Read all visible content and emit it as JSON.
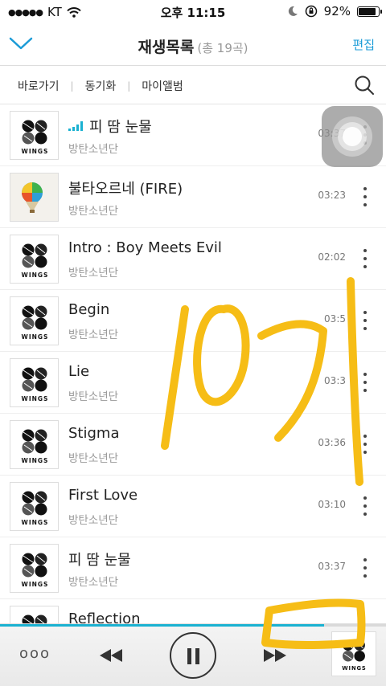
{
  "status_bar": {
    "carrier": "KT",
    "time": "오후 11:15",
    "battery": "92%",
    "battery_level": 0.92
  },
  "header": {
    "title": "재생목록",
    "count": "(총 19곡)",
    "edit_label": "편집",
    "back_icon": "chevron-down-icon"
  },
  "subnav": {
    "items": [
      "바로가기",
      "동기화",
      "마이앨범"
    ],
    "search_icon": "search-icon"
  },
  "songs": [
    {
      "title": "피 땀 눈물",
      "artist": "방탄소년단",
      "duration": "03:37",
      "playing": true
    },
    {
      "title": "불타오르네 (FIRE)",
      "artist": "방탄소년단",
      "duration": "03:23"
    },
    {
      "title": "Intro : Boy Meets Evil",
      "artist": "방탄소년단",
      "duration": "02:02"
    },
    {
      "title": "Begin",
      "artist": "방탄소년단",
      "duration": "03:5"
    },
    {
      "title": "Lie",
      "artist": "방탄소년단",
      "duration": "03:3"
    },
    {
      "title": "Stigma",
      "artist": "방탄소년단",
      "duration": "03:36"
    },
    {
      "title": "First Love",
      "artist": "방탄소년단",
      "duration": "03:10"
    },
    {
      "title": "피 땀 눈물",
      "artist": "방탄소년단",
      "duration": "03:37"
    },
    {
      "title": "Reflection",
      "artist": "",
      "duration": ""
    }
  ],
  "album_label": "WINGS",
  "player": {
    "progress": 0.84,
    "more_label": "ooo"
  },
  "colors": {
    "accent": "#1a9bd7",
    "highlight": "#f6bd16"
  }
}
